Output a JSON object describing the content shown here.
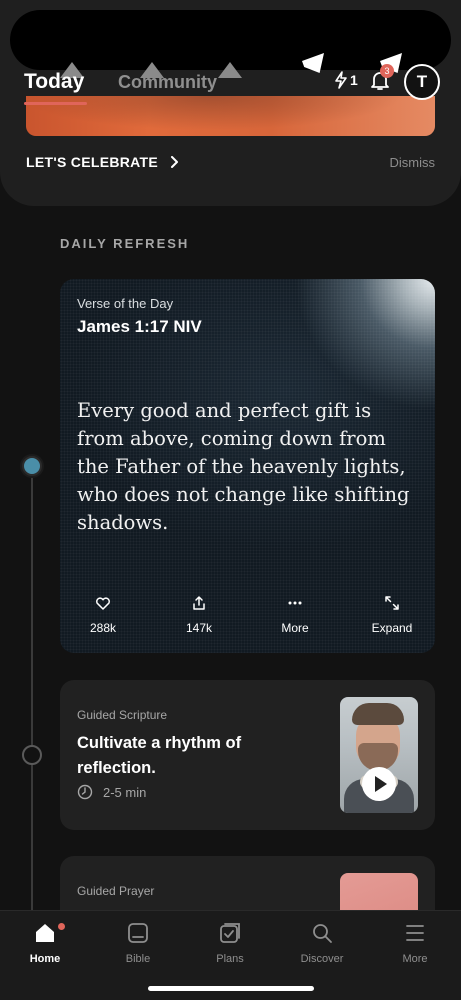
{
  "celebrate": {
    "cta_label": "LET'S CELEBRATE",
    "dismiss_label": "Dismiss"
  },
  "header": {
    "tabs": [
      {
        "label": "Today",
        "active": true
      },
      {
        "label": "Community",
        "active": false
      }
    ],
    "streak_count": "1",
    "notification_count": "3",
    "avatar_initial": "T"
  },
  "section_title": "DAILY REFRESH",
  "verse": {
    "kicker": "Verse of the Day",
    "reference": "James 1:17 NIV",
    "text": "Every good and perfect gift is from above, coming down from the Father of the heavenly lights, who does not change like shifting shadows.",
    "actions": [
      {
        "label": "288k",
        "icon": "heart-icon"
      },
      {
        "label": "147k",
        "icon": "share-icon"
      },
      {
        "label": "More",
        "icon": "more-icon"
      },
      {
        "label": "Expand",
        "icon": "expand-icon"
      }
    ]
  },
  "guided_scripture": {
    "kicker": "Guided Scripture",
    "title": "Cultivate a rhythm of reflection.",
    "duration": "2-5 min"
  },
  "guided_prayer": {
    "kicker": "Guided Prayer"
  },
  "bottom_nav": {
    "items": [
      {
        "label": "Home",
        "icon": "home-icon",
        "active": true
      },
      {
        "label": "Bible",
        "icon": "bible-icon",
        "active": false
      },
      {
        "label": "Plans",
        "icon": "plans-icon",
        "active": false
      },
      {
        "label": "Discover",
        "icon": "discover-icon",
        "active": false
      },
      {
        "label": "More",
        "icon": "menu-icon",
        "active": false
      }
    ]
  },
  "colors": {
    "accent": "#e0655a",
    "timeline_active": "#4a8ea8",
    "background": "#121212",
    "card": "#212121"
  }
}
